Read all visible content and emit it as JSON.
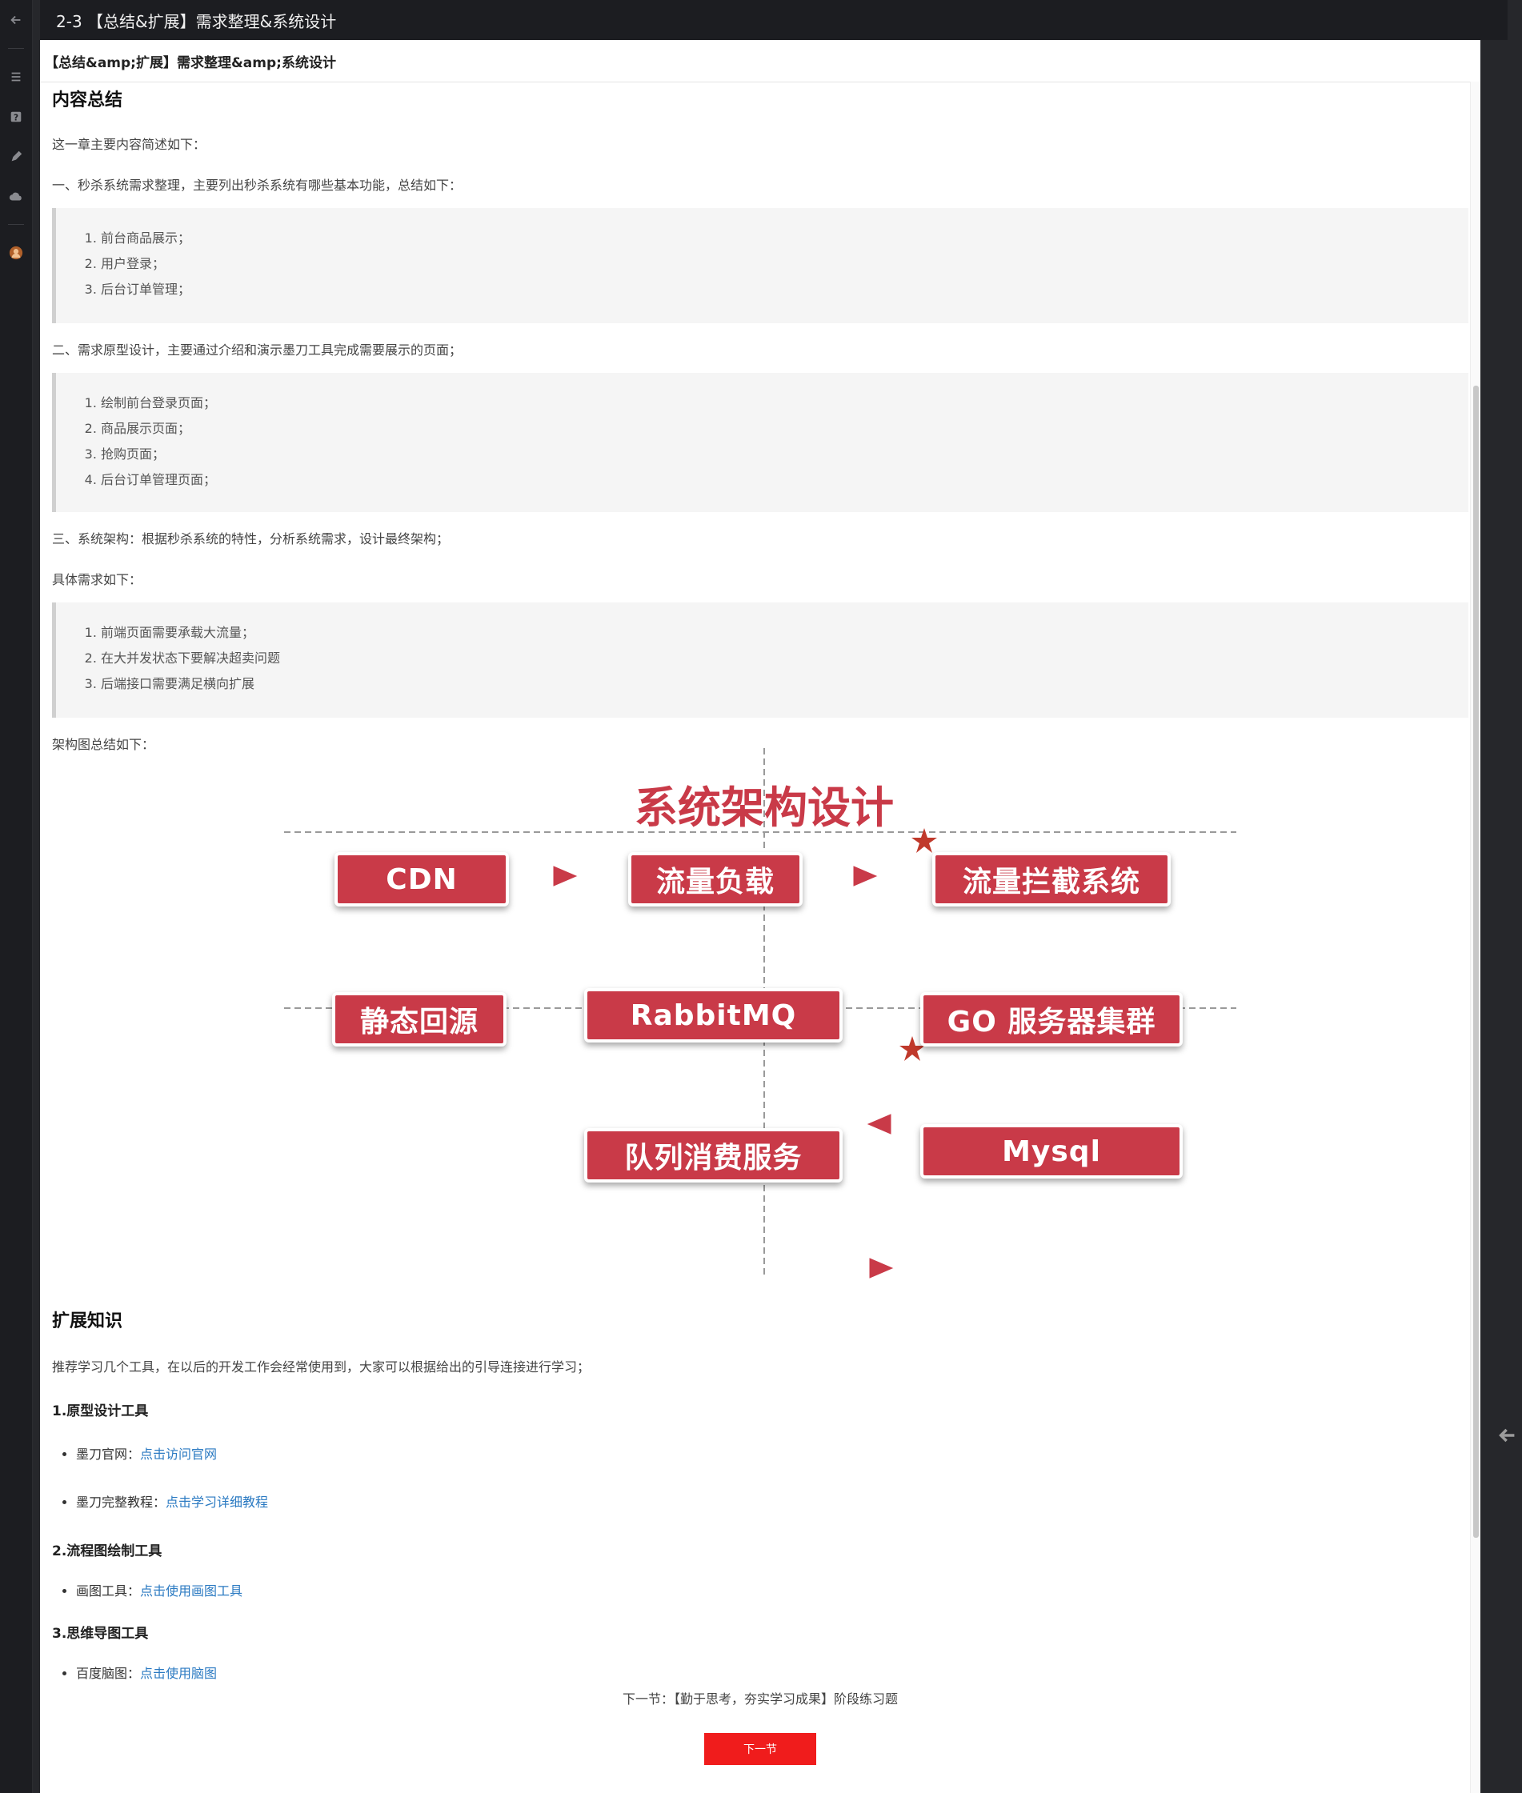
{
  "window": {
    "title": "2-3 【总结&扩展】需求整理&系统设计"
  },
  "doc": {
    "header": "【总结&amp;扩展】需求整理&amp;系统设计"
  },
  "summary": {
    "heading": "内容总结",
    "intro": "这一章主要内容简述如下：",
    "part1": "一、秒杀系统需求整理，主要列出秒杀系统有哪些基本功能，总结如下：",
    "list1": [
      "前台商品展示；",
      "用户登录；",
      "后台订单管理；"
    ],
    "part2": "二、需求原型设计，主要通过介绍和演示墨刀工具完成需要展示的页面；",
    "list2": [
      "绘制前台登录页面；",
      "商品展示页面；",
      "抢购页面；",
      "后台订单管理页面；"
    ],
    "part3": "三、系统架构：根据秒杀系统的特性，分析系统需求，设计最终架构；",
    "detail": "具体需求如下：",
    "list3": [
      "前端页面需要承载大流量；",
      "在大并发状态下要解决超卖问题",
      "后端接口需要满足横向扩展"
    ],
    "diagram_intro": "架构图总结如下："
  },
  "diagram": {
    "title": "系统架构设计",
    "nodes": {
      "cdn": "CDN",
      "load": "流量负载",
      "intercept": "流量拦截系统",
      "static": "静态回源",
      "rabbitmq": "RabbitMQ",
      "go": "GO 服务器集群",
      "queue": "队列消费服务",
      "mysql": "Mysql"
    },
    "colors": {
      "box": "#c93a48",
      "arrow": "#c93a48",
      "star": "#c0392b"
    }
  },
  "extension": {
    "heading": "扩展知识",
    "intro": "推荐学习几个工具，在以后的开发工作会经常使用到，大家可以根据给出的引导连接进行学习；",
    "s1_title": "1.原型设计工具",
    "s1_item1_label": "墨刀官网：",
    "s1_item1_link": "点击访问官网",
    "s1_item2_label": "墨刀完整教程：",
    "s1_item2_link": "点击学习详细教程",
    "s2_title": "2.流程图绘制工具",
    "s2_item1_label": "画图工具：",
    "s2_item1_link": "点击使用画图工具",
    "s3_title": "3.思维导图工具",
    "s3_item1_label": "百度脑图：",
    "s3_item1_link": "点击使用脑图"
  },
  "footer": {
    "next_text": "下一节：【勤于思考，夯实学习成果】阶段练习题",
    "next_button": "下一节"
  },
  "icons": {
    "back": "back-arrow-icon",
    "menu": "menu-icon",
    "help": "help-icon",
    "edit": "pencil-icon",
    "cloud": "cloud-icon",
    "avatar": "avatar"
  }
}
